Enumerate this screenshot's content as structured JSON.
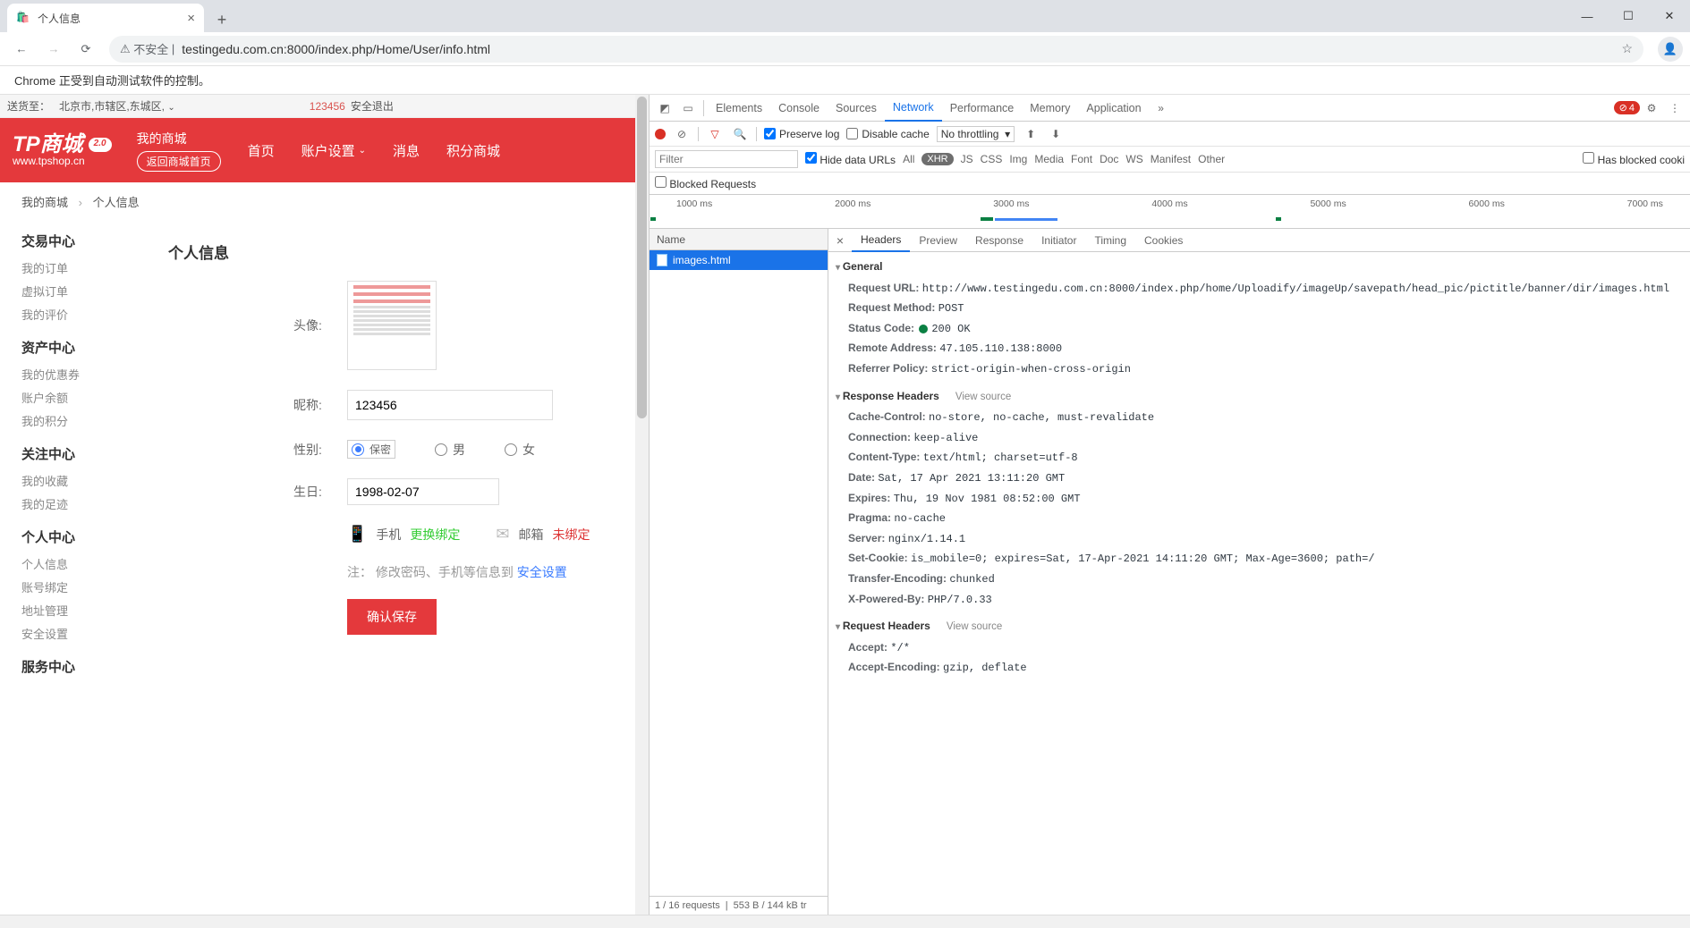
{
  "browser": {
    "tab_title": "个人信息",
    "url_prefix_label": "不安全",
    "url": "testingedu.com.cn:8000/index.php/Home/User/info.html",
    "infobar": "Chrome 正受到自动测试软件的控制。"
  },
  "page": {
    "topbar": {
      "ship_label": "送货至：",
      "location": "北京市,市辖区,东城区,",
      "user": "123456",
      "logout": "安全退出"
    },
    "header": {
      "logo_main": "TP商城",
      "logo_badge": "2.0",
      "logo_sub": "www.tpshop.cn",
      "my_mall": "我的商城",
      "return_btn": "返回商城首页",
      "nav": [
        "首页",
        "账户设置",
        "消息",
        "积分商城"
      ]
    },
    "crumb": {
      "a": "我的商城",
      "b": "个人信息"
    },
    "leftnav": {
      "g1": {
        "title": "交易中心",
        "items": [
          "我的订单",
          "虚拟订单",
          "我的评价"
        ]
      },
      "g2": {
        "title": "资产中心",
        "items": [
          "我的优惠券",
          "账户余额",
          "我的积分"
        ]
      },
      "g3": {
        "title": "关注中心",
        "items": [
          "我的收藏",
          "我的足迹"
        ]
      },
      "g4": {
        "title": "个人中心",
        "items": [
          "个人信息",
          "账号绑定",
          "地址管理",
          "安全设置"
        ]
      },
      "g5": {
        "title": "服务中心"
      }
    },
    "form": {
      "title": "个人信息",
      "avatar_label": "头像:",
      "nick_label": "昵称:",
      "nick_value": "123456",
      "gender_label": "性别:",
      "gender_opts": [
        "保密",
        "男",
        "女"
      ],
      "birth_label": "生日:",
      "birth_value": "1998-02-07",
      "phone_label": "手机",
      "phone_action": "更换绑定",
      "email_label": "邮箱",
      "email_action": "未绑定",
      "note_prefix": "注：",
      "note_text": "修改密码、手机等信息到",
      "note_link": "安全设置",
      "submit": "确认保存"
    }
  },
  "devtools": {
    "tabs": [
      "Elements",
      "Console",
      "Sources",
      "Network",
      "Performance",
      "Memory",
      "Application"
    ],
    "active_tab": "Network",
    "error_count": "4",
    "toolbar": {
      "preserve_log": "Preserve log",
      "disable_cache": "Disable cache",
      "throttle": "No throttling"
    },
    "filter": {
      "placeholder": "Filter",
      "hide_data_urls": "Hide data URLs",
      "types": [
        "All",
        "XHR",
        "JS",
        "CSS",
        "Img",
        "Media",
        "Font",
        "Doc",
        "WS",
        "Manifest",
        "Other"
      ],
      "active_type": "XHR",
      "blocked_cookies": "Has blocked cooki",
      "blocked_requests": "Blocked Requests"
    },
    "timeline_marks": [
      "1000 ms",
      "2000 ms",
      "3000 ms",
      "4000 ms",
      "5000 ms",
      "6000 ms",
      "7000 ms"
    ],
    "requests": {
      "col_name": "Name",
      "items": [
        "images.html"
      ],
      "status": "1 / 16 requests",
      "transfer": "553 B / 144 kB tr"
    },
    "detail_tabs": [
      "Headers",
      "Preview",
      "Response",
      "Initiator",
      "Timing",
      "Cookies"
    ],
    "detail_active": "Headers",
    "general": {
      "title": "General",
      "request_url_k": "Request URL:",
      "request_url_v": "http://www.testingedu.com.cn:8000/index.php/home/Uploadify/imageUp/savepath/head_pic/pictitle/banner/dir/images.html",
      "method_k": "Request Method:",
      "method_v": "POST",
      "status_k": "Status Code:",
      "status_v": "200 OK",
      "remote_k": "Remote Address:",
      "remote_v": "47.105.110.138:8000",
      "referrer_k": "Referrer Policy:",
      "referrer_v": "strict-origin-when-cross-origin"
    },
    "response_headers": {
      "title": "Response Headers",
      "view_source": "View source",
      "items": [
        {
          "k": "Cache-Control:",
          "v": "no-store, no-cache, must-revalidate"
        },
        {
          "k": "Connection:",
          "v": "keep-alive"
        },
        {
          "k": "Content-Type:",
          "v": "text/html; charset=utf-8"
        },
        {
          "k": "Date:",
          "v": "Sat, 17 Apr 2021 13:11:20 GMT"
        },
        {
          "k": "Expires:",
          "v": "Thu, 19 Nov 1981 08:52:00 GMT"
        },
        {
          "k": "Pragma:",
          "v": "no-cache"
        },
        {
          "k": "Server:",
          "v": "nginx/1.14.1"
        },
        {
          "k": "Set-Cookie:",
          "v": "is_mobile=0; expires=Sat, 17-Apr-2021 14:11:20 GMT; Max-Age=3600; path=/"
        },
        {
          "k": "Transfer-Encoding:",
          "v": "chunked"
        },
        {
          "k": "X-Powered-By:",
          "v": "PHP/7.0.33"
        }
      ]
    },
    "request_headers": {
      "title": "Request Headers",
      "view_source": "View source",
      "items": [
        {
          "k": "Accept:",
          "v": "*/*"
        },
        {
          "k": "Accept-Encoding:",
          "v": "gzip, deflate"
        }
      ]
    }
  }
}
